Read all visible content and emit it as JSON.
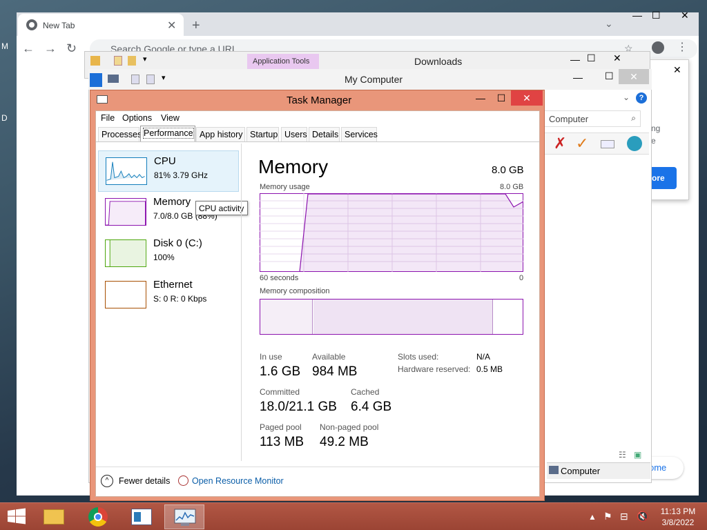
{
  "chrome": {
    "tab_title": "New Tab",
    "tab_close": "✕",
    "new_tab": "+",
    "omnibox_placeholder": "Search Google or type a URL"
  },
  "downloads": {
    "title": "Downloads",
    "ribbon_label": "Application Tools"
  },
  "my_computer": {
    "title": "My Computer",
    "search_text": "Computer",
    "status_text": "Computer"
  },
  "chrome_dialog": {
    "line1": "ng",
    "line2": "e",
    "button_label": "ore",
    "welcome_fragment": "ome"
  },
  "task_manager": {
    "title": "Task Manager",
    "menu": [
      "File",
      "Options",
      "View"
    ],
    "tabs": [
      "Processes",
      "Performance",
      "App history",
      "Startup",
      "Users",
      "Details",
      "Services"
    ],
    "active_tab": "Performance",
    "sidebar": [
      {
        "name": "CPU",
        "sub": "81%  3.79 GHz",
        "color": "#117dbb"
      },
      {
        "name": "Memory",
        "sub": "7.0/8.0 GB (88%)",
        "color": "#8b12ae"
      },
      {
        "name": "Disk 0 (C:)",
        "sub": "100%",
        "color": "#4da60c"
      },
      {
        "name": "Ethernet",
        "sub": "S: 0 R: 0 Kbps",
        "color": "#a74f01"
      }
    ],
    "tooltip": "CPU activity",
    "memory": {
      "heading": "Memory",
      "total": "8.0 GB",
      "usage_label": "Memory usage",
      "usage_max": "8.0 GB",
      "axis_left": "60 seconds",
      "axis_right": "0",
      "composition_label": "Memory composition",
      "stats": {
        "in_use_label": "In use",
        "in_use": "1.6 GB",
        "available_label": "Available",
        "available": "984 MB",
        "committed_label": "Committed",
        "committed": "18.0/21.1 GB",
        "cached_label": "Cached",
        "cached": "6.4 GB",
        "paged_label": "Paged pool",
        "paged": "113 MB",
        "nonpaged_label": "Non-paged pool",
        "nonpaged": "49.2 MB",
        "slots_label": "Slots used:",
        "slots": "N/A",
        "reserved_label": "Hardware reserved:",
        "reserved": "0.5 MB"
      }
    },
    "fewer_details": "Fewer details",
    "open_resmon": "Open Resource Monitor",
    "graph_color": "#8b12ae"
  },
  "taskbar": {
    "time": "11:13 PM",
    "date": "3/8/2022",
    "items": [
      "start-button",
      "file-explorer",
      "chrome",
      "control-panel-window",
      "task-manager"
    ]
  }
}
